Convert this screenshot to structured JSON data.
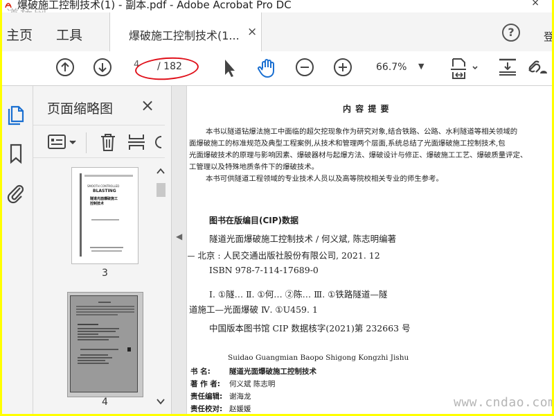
{
  "window": {
    "title": "爆破施工控制技术(1) - 副本.pdf - Adobe Acrobat Pro DC",
    "close_glyph": "×"
  },
  "watermarks": {
    "top_left": "道桥网",
    "bottom_right": "www.cndao.com"
  },
  "nav": {
    "home": "主页",
    "tools": "工具",
    "doc_tab": "爆破施工控制技术(1...",
    "doc_tab_close": "×",
    "help": "?",
    "login_partial": "登"
  },
  "toolbar": {
    "page_current": "4",
    "page_total": "/ 182",
    "zoom": "66.7%",
    "icons": [
      "prev-page-icon",
      "next-page-icon",
      "select-arrow-icon",
      "hand-tool-icon",
      "zoom-out-icon",
      "zoom-in-icon",
      "page-fit-icon",
      "scroll-mode-icon",
      "share-link-icon"
    ]
  },
  "left_rail": {
    "icons": [
      "page-thumbnails-icon",
      "bookmarks-icon",
      "attachments-icon"
    ]
  },
  "thumbnails_panel": {
    "title": "页面缩略图",
    "close": "×",
    "pages": [
      {
        "label": "3",
        "en_title": "SMOOTH CONTROLLED",
        "en_title2": "BLASTING",
        "cn_title": "隧道光面爆破施工控制技术"
      },
      {
        "label": "4"
      }
    ]
  },
  "document": {
    "heading": "内 容 提 要",
    "para1_lines": [
      "本书以隧道钻爆法施工中面临的超欠挖现象作为研究对象,结合铁路、公路、水利隧道等相关领域的",
      "面爆破施工的标准规范及典型工程案例,从技术和管理两个层面,系统总结了光面爆破施工控制技术,包",
      "光面爆破技术的原理与影响因素、爆破器材与起爆方法、爆破设计与修正、爆破施工工艺、爆破质量评定、",
      "工管理以及特殊地质条件下的爆破技术。"
    ],
    "para2": "本书可供隧道工程领域的专业技术人员以及高等院校相关专业的师生参考。",
    "cip_heading": "图书在版编目(CIP)数据",
    "cip_lines": [
      "隧道光面爆破施工控制技术 / 何义斌, 陈志明编著",
      ". — 北京 : 人民交通出版社股份有限公司, 2021. 12",
      "ISBN 978-7-114-17689-0"
    ],
    "classification_lines": [
      "Ⅰ. ①隧…  Ⅱ. ①何…  ②陈…  Ⅲ. ①铁路隧道—隧",
      "道施工—光面爆破  Ⅳ. ①U459. 1"
    ],
    "cip_number": "中国版本图书馆 CIP 数据核字(2021)第 232663 号",
    "pinyin_title": "Suidao Guangmian Baopo Shigong Kongzhi Jishu",
    "credits": [
      {
        "k": "书      名:",
        "v": "隧道光面爆破施工控制技术"
      },
      {
        "k": "著  作  者:",
        "v": "何义斌    陈志明"
      },
      {
        "k": "责任编辑:",
        "v": "谢海龙"
      },
      {
        "k": "责任校对:",
        "v": "赵媛媛"
      }
    ]
  },
  "colors": {
    "outer_border": "#ffff00",
    "annotation_ellipse": "#e0101a",
    "acrobat_red": "#d81e05"
  }
}
